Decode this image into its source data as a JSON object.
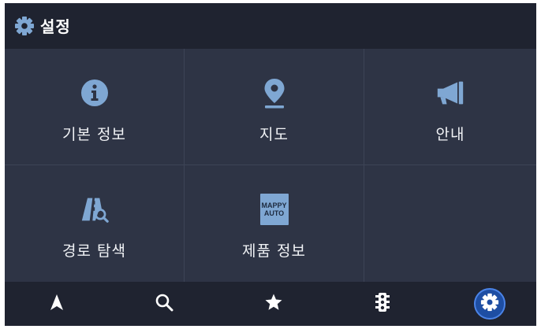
{
  "header": {
    "title": "설정",
    "icon": "gear-icon"
  },
  "colors": {
    "background": "#2e3445",
    "bar": "#1f2330",
    "accent": "#7fa7d3",
    "active": "#1e4ea3"
  },
  "menu": [
    {
      "label": "기본 정보",
      "icon": "info-icon"
    },
    {
      "label": "지도",
      "icon": "map-pin-icon"
    },
    {
      "label": "안내",
      "icon": "megaphone-icon"
    },
    {
      "label": "경로 탐색",
      "icon": "route-search-icon"
    },
    {
      "label": "제품 정보",
      "icon": "mappy-auto-logo",
      "logo_text": [
        "MAPPY",
        "AUTO"
      ]
    }
  ],
  "bottom_nav": [
    {
      "name": "navigation",
      "icon": "navigation-arrow-icon",
      "active": false
    },
    {
      "name": "search",
      "icon": "search-icon",
      "active": false
    },
    {
      "name": "favorites",
      "icon": "star-icon",
      "active": false
    },
    {
      "name": "traffic",
      "icon": "traffic-light-icon",
      "active": false
    },
    {
      "name": "settings",
      "icon": "gear-icon",
      "active": true
    }
  ]
}
